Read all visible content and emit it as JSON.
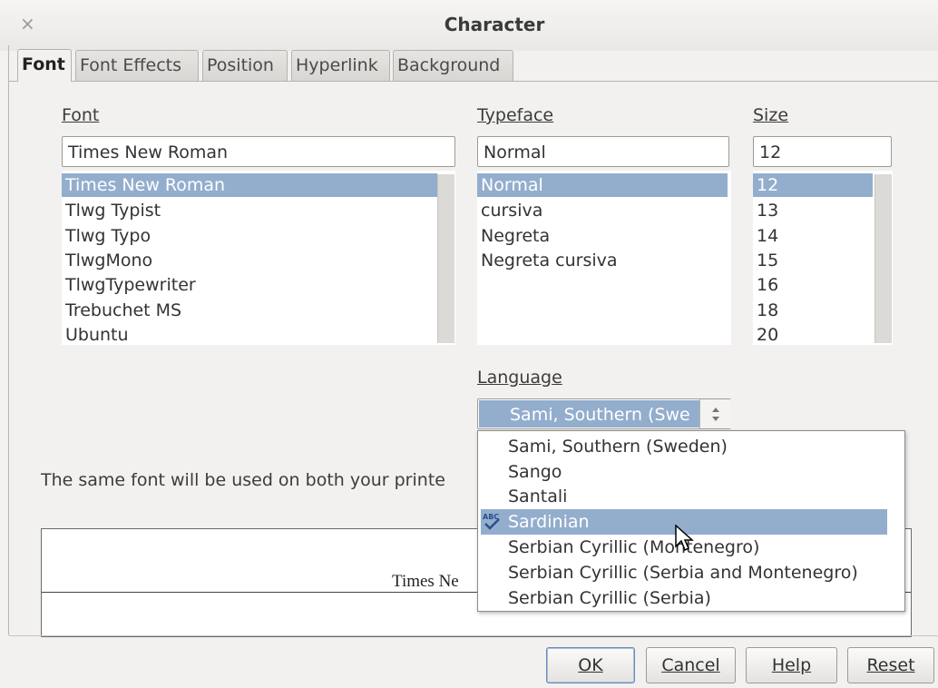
{
  "window": {
    "title": "Character"
  },
  "tabs": [
    "Font",
    "Font Effects",
    "Position",
    "Hyperlink",
    "Background"
  ],
  "font": {
    "label": "Font",
    "value": "Times New Roman",
    "items": [
      "Times New Roman",
      "Tlwg Typist",
      "Tlwg Typo",
      "TlwgMono",
      "TlwgTypewriter",
      "Trebuchet MS",
      "Ubuntu"
    ],
    "selected_index": 0
  },
  "typeface": {
    "label": "Typeface",
    "value": "Normal",
    "items": [
      "Normal",
      "cursiva",
      "Negreta",
      "Negreta cursiva"
    ],
    "selected_index": 0
  },
  "size": {
    "label": "Size",
    "value": "12",
    "items": [
      "12",
      "13",
      "14",
      "15",
      "16",
      "18",
      "20"
    ],
    "selected_index": 0
  },
  "language": {
    "label": "Language",
    "value": "Sami, Southern (Swe",
    "options": [
      "Sami, Southern (Sweden)",
      "Sango",
      "Santali",
      "Sardinian",
      "Serbian Cyrillic (Montenegro)",
      "Serbian Cyrillic (Serbia and Montenegro)",
      "Serbian Cyrillic (Serbia)"
    ],
    "highlighted_index": 3,
    "spellcheck_icon": "spellcheck-icon"
  },
  "info": {
    "text": "The same font will be used on both your printe"
  },
  "preview": {
    "text": "Times Ne"
  },
  "buttons": {
    "ok": "OK",
    "cancel": "Cancel",
    "help": "Help",
    "reset": "Reset"
  },
  "colors": {
    "selection": "#93adcd",
    "dialog_bg": "#f2f1f0"
  }
}
